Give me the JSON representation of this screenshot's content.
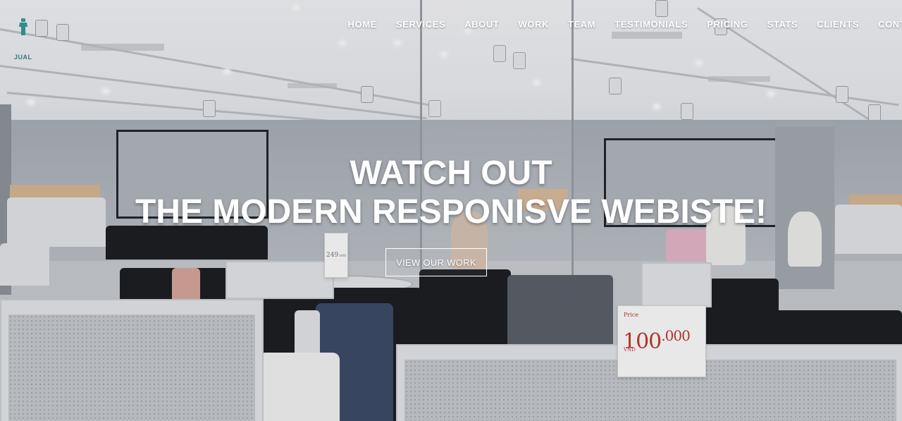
{
  "brand": {
    "logo_icon": "shirt-icon",
    "logo_text": "JUAL",
    "accent_color": "#2f8f86"
  },
  "nav": {
    "items": [
      {
        "label": "HOME"
      },
      {
        "label": "SERVICES"
      },
      {
        "label": "ABOUT"
      },
      {
        "label": "WORK"
      },
      {
        "label": "TEAM"
      },
      {
        "label": "TESTIMONIALS"
      },
      {
        "label": "PRICING"
      },
      {
        "label": "STATS"
      },
      {
        "label": "CLIENTS"
      },
      {
        "label": "CONTACT"
      }
    ]
  },
  "hero": {
    "title_line1": "WATCH OUT",
    "title_line2": "THE MODERN RESPONISVE WEBISTE!",
    "cta_label": "VIEW OUR WORK"
  },
  "background": {
    "price_sign_large": {
      "label": "Price",
      "price": "100",
      "decimals": ".000",
      "unit": "VND"
    },
    "price_sign_small": {
      "price": "249",
      "decimals": ".000"
    }
  }
}
